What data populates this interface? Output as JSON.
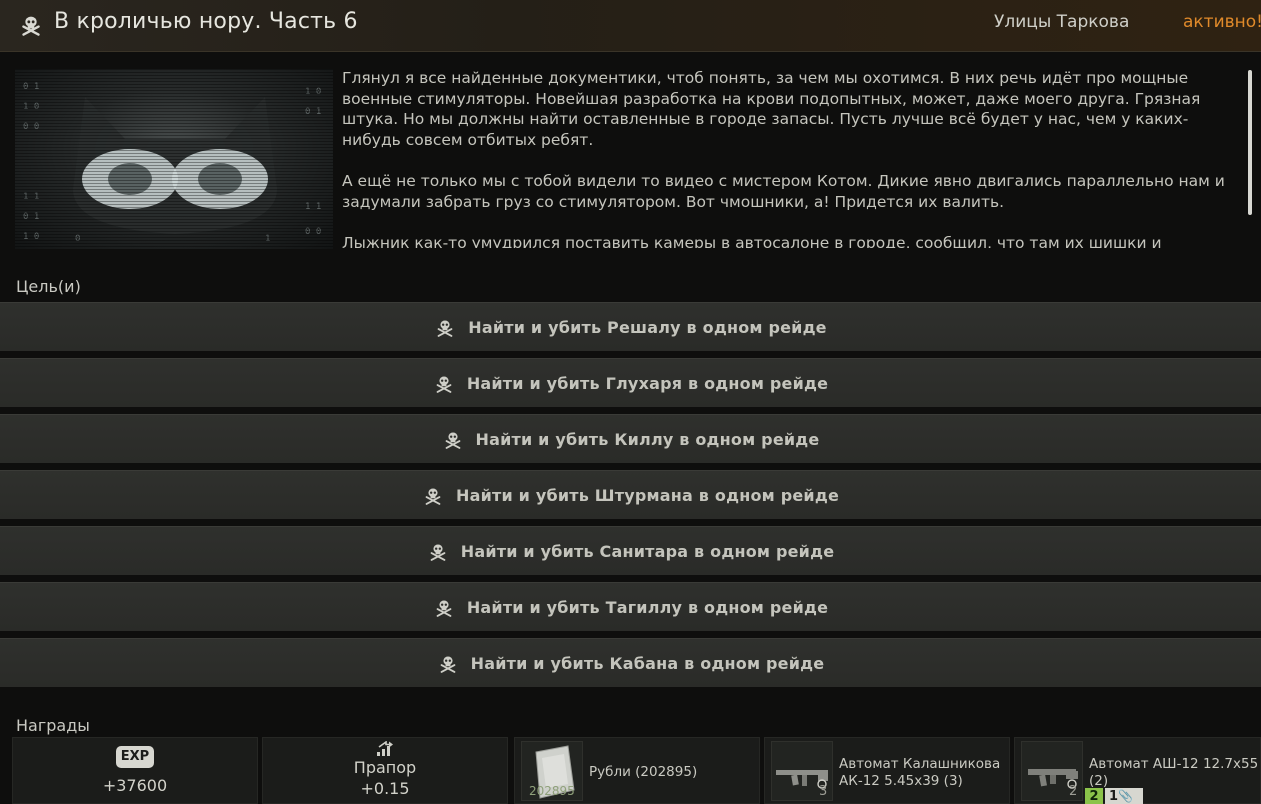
{
  "header": {
    "title": "В кроличью нору. Часть 6",
    "location": "Улицы Таркова",
    "status": "активно!",
    "icon": "skull-icon",
    "status_color": "#e08a2a"
  },
  "description": {
    "paragraphs": [
      "Глянул я все найденные документики, чтоб понять, за чем мы охотимся. В них речь идёт про мощные военные стимуляторы. Новейшая разработка на крови подопытных, может, даже моего друга. Грязная штука. Но мы должны найти оставленные в городе запасы. Пусть лучше всё будет у нас, чем у каких-нибудь совсем отбитых ребят.",
      "А ещё не только мы с тобой видели то видео с мистером Котом. Дикие явно двигались параллельно нам и задумали забрать груз со стимулятором. Вот чмошники, а! Придется их валить.",
      "Лыжник как-то умудрился поставить камеры в автосалоне в городе, сообщил, что там их шишки и"
    ]
  },
  "objectives": {
    "label": "Цель(и)",
    "icon": "skull-icon",
    "items": [
      "Найти и убить Решалу в одном рейде",
      "Найти и убить Глухаря в одном рейде",
      "Найти и убить Киллу в одном рейде",
      "Найти и убить Штурмана в одном рейде",
      "Найти и убить Санитара в одном рейде",
      "Найти и убить Тагиллу в одном рейде",
      "Найти и убить Кабана в одном рейде"
    ]
  },
  "rewards": {
    "label": "Награды",
    "exp": {
      "badge": "EXP",
      "value": "+37600",
      "icon": "exp-badge-icon"
    },
    "standing": {
      "trader": "Прапор",
      "value": "+0.15",
      "icon": "standing-up-icon"
    },
    "money": {
      "name": "Рубли (202895)",
      "amount": "202895",
      "icon": "rubles-icon"
    },
    "item1": {
      "name_line1": "Автомат Калашникова",
      "name_line2": "АК-12 5.45x39 (3)",
      "qty": "3",
      "icon": "assault-rifle-icon"
    },
    "item2": {
      "name_line1": "Автомат АШ-12 12.7x55",
      "name_line2": "(2)",
      "qty": "2",
      "badge_green": "2",
      "badge_gray": "1",
      "icon": "assault-rifle-icon"
    }
  }
}
